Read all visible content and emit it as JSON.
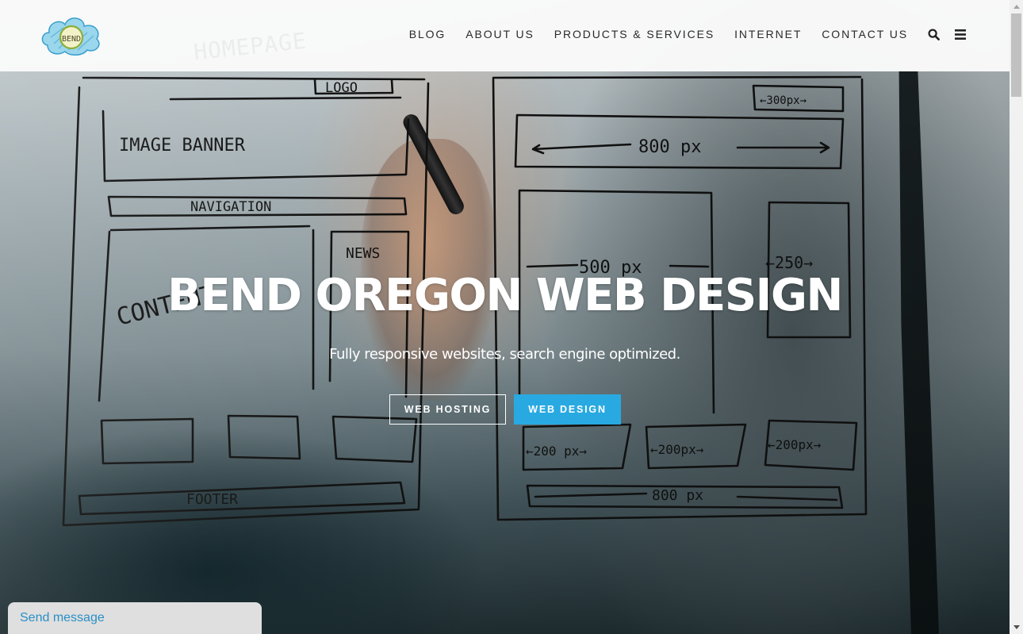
{
  "header": {
    "logo_text": "BEND",
    "ghost_sketch_text": "HOMEPAGE",
    "nav": [
      {
        "label": "BLOG"
      },
      {
        "label": "ABOUT US"
      },
      {
        "label": "PRODUCTS & SERVICES"
      },
      {
        "label": "INTERNET"
      },
      {
        "label": "CONTACT US"
      }
    ],
    "icons": {
      "search": "search-icon",
      "menu": "hamburger-menu-icon"
    }
  },
  "hero": {
    "title": "BEND OREGON WEB DESIGN",
    "subtitle": "Fully responsive websites, search engine optimized.",
    "buttons": [
      {
        "label": "WEB HOSTING",
        "style": "outline"
      },
      {
        "label": "WEB DESIGN",
        "style": "filled"
      }
    ],
    "background_sketch_labels": {
      "logo": "LOGO",
      "image_banner": "IMAGE BANNER",
      "navigation": "NAVIGATION",
      "content": "CONTENT",
      "news": "NEWS",
      "footer": "FOOTER",
      "w300": "←300px→",
      "w800_top": "800 px",
      "w500": "500 px",
      "w250": "←250→",
      "w200_a": "←200 px→",
      "w200_b": "←200px→",
      "w200_c": "←200px→",
      "w800_bottom": "800 px"
    }
  },
  "chat_widget": {
    "label": "Send message"
  },
  "colors": {
    "accent": "#29a9e1",
    "header_bg": "#fafafa",
    "nav_text": "#2a2a2a",
    "chat_text": "#2a8fc6",
    "chat_bg": "#dfdfdf"
  }
}
